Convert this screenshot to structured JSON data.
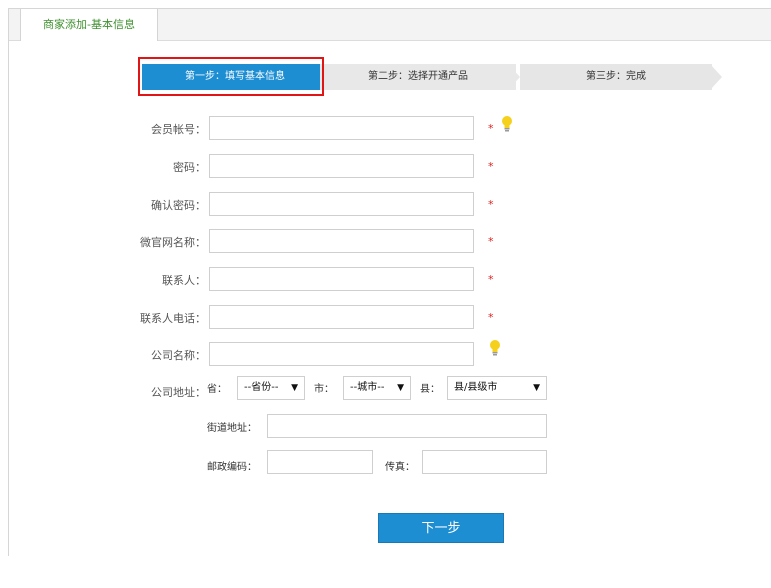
{
  "tab": {
    "title": "商家添加-基本信息"
  },
  "steps": [
    {
      "label": "第一步：填写基本信息"
    },
    {
      "label": "第二步：选择开通产品"
    },
    {
      "label": "第三步：完成"
    }
  ],
  "form": {
    "member_account": {
      "label": "会员帐号：",
      "value": "",
      "required": "*"
    },
    "password": {
      "label": "密码：",
      "value": "",
      "required": "*"
    },
    "confirm_password": {
      "label": "确认密码：",
      "value": "",
      "required": "*"
    },
    "site_name": {
      "label": "微官网名称：",
      "value": "",
      "required": "*"
    },
    "contact": {
      "label": "联系人：",
      "value": "",
      "required": "*"
    },
    "contact_phone": {
      "label": "联系人电话：",
      "value": "",
      "required": "*"
    },
    "company_name": {
      "label": "公司名称：",
      "value": ""
    },
    "company_address": {
      "label": "公司地址：",
      "province_label": "省：",
      "province_value": "--省份--",
      "city_label": "市：",
      "city_value": "--城市--",
      "county_label": "县：",
      "county_value": "县/县级市",
      "street_label": "街道地址：",
      "street_value": "",
      "zip_label": "邮政编码：",
      "zip_value": "",
      "fax_label": "传真：",
      "fax_value": ""
    }
  },
  "next_button": {
    "label": "下一步"
  },
  "colors": {
    "accent": "#1e8ed3",
    "tab_text": "#3e8f2e",
    "required": "#e02020",
    "highlight": "#e01515"
  },
  "icons": {
    "hint": "lightbulb-icon",
    "caret": "caret-down-icon"
  }
}
